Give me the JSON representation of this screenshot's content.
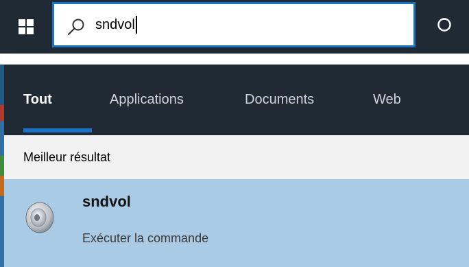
{
  "taskbar": {
    "start_icon": "windows-logo-icon",
    "search": {
      "icon": "search-icon",
      "value": "sndvol"
    },
    "cortana_icon": "cortana-circle-icon"
  },
  "results_panel": {
    "tabs": [
      {
        "label": "Tout",
        "active": true
      },
      {
        "label": "Applications",
        "active": false
      },
      {
        "label": "Documents",
        "active": false
      },
      {
        "label": "Web",
        "active": false
      }
    ],
    "section_title": "Meilleur résultat",
    "best_result": {
      "icon": "speaker-icon",
      "title": "sndvol",
      "subtitle": "Exécuter la commande"
    }
  },
  "colors": {
    "taskbar_bg": "#1f2a34",
    "accent": "#1a73c7",
    "result_highlight": "#a9cbe6"
  }
}
